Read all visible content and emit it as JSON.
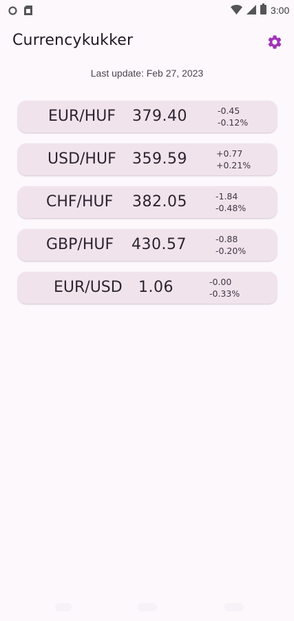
{
  "status_bar": {
    "time": "3:00",
    "left_icons": [
      "circle-icon",
      "sim-card-icon"
    ],
    "right_icons": [
      "wifi-icon",
      "signal-icon",
      "battery-icon"
    ]
  },
  "app": {
    "title": "Currencykukker",
    "settings_icon": "gear-icon",
    "accent_color": "#a033b8"
  },
  "last_update": "Last update: Feb 27, 2023",
  "rates": [
    {
      "pair": "EUR/HUF",
      "rate": "379.40",
      "change_abs": "-0.45",
      "change_pct": "-0.12%"
    },
    {
      "pair": "USD/HUF",
      "rate": "359.59",
      "change_abs": "+0.77",
      "change_pct": "+0.21%"
    },
    {
      "pair": "CHF/HUF",
      "rate": "382.05",
      "change_abs": "-1.84",
      "change_pct": "-0.48%"
    },
    {
      "pair": "GBP/HUF",
      "rate": "430.57",
      "change_abs": "-0.88",
      "change_pct": "-0.20%"
    },
    {
      "pair": "EUR/USD",
      "rate": "1.06",
      "change_abs": "-0.00",
      "change_pct": "-0.33%"
    }
  ]
}
